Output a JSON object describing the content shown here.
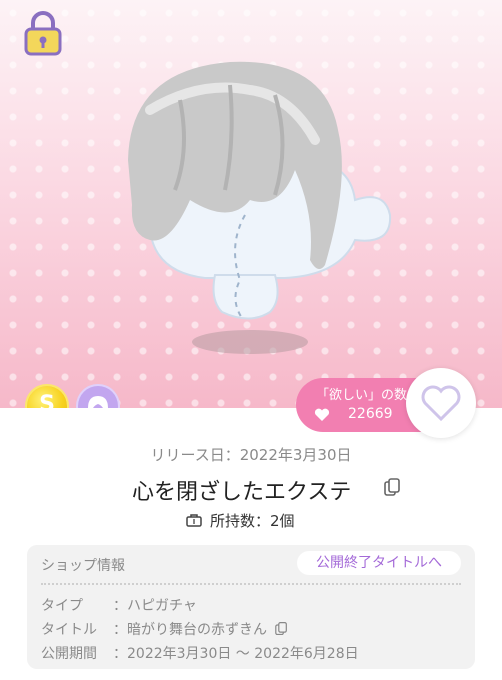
{
  "item": {
    "release_date": "リリース日：2022年3月30日",
    "name": "心を閉ざしたエクステ",
    "owned": "所持数：2個"
  },
  "wishlist": {
    "label": "「欲しい」の数",
    "count": "22669"
  },
  "badges": {
    "shop_coin": "S"
  },
  "shop": {
    "title": "ショップ情報",
    "end_button": "公開終了タイトルへ",
    "rows": [
      {
        "key": "タイプ",
        "value": "：ハピガチャ"
      },
      {
        "key": "タイトル",
        "value": "：暗がり舞台の赤ずきん"
      },
      {
        "key": "公開期間",
        "value": "：2022年3月30日 〜 2022年6月28日"
      }
    ]
  },
  "colors": {
    "wish_pill": "#f27fb1",
    "accent_purple": "#a46ad8",
    "lock": "#e8c74a"
  },
  "icons": [
    "lock-icon",
    "heart-icon",
    "copy-icon",
    "bag-icon",
    "coin-s-icon",
    "hair-category-icon"
  ]
}
